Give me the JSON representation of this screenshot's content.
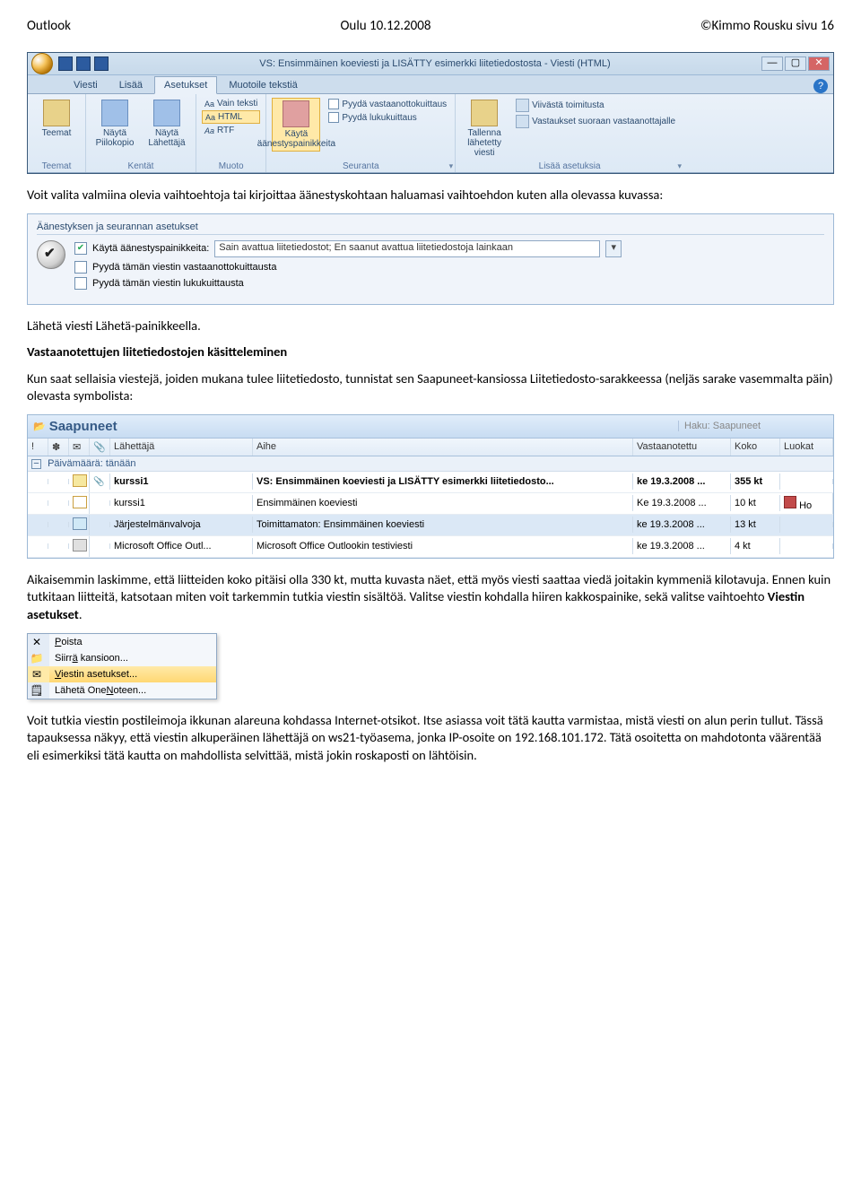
{
  "page_header": {
    "left": "Outlook",
    "center": "Oulu 10.12.2008",
    "right": "©Kimmo Rousku   sivu  16"
  },
  "outlook_window": {
    "title": "VS: Ensimmäinen koeviesti ja LISÄTTY esimerkki liitetiedostosta - Viesti (HTML)",
    "tabs": [
      "Viesti",
      "Lisää",
      "Asetukset",
      "Muotoile tekstiä"
    ],
    "active_tab": "Asetukset",
    "groups": {
      "teemat": "Teemat",
      "kentat": "Kentät",
      "muoto": "Muoto",
      "seuranta": "Seuranta",
      "lisaa": "Lisää asetuksia"
    },
    "buttons": {
      "teemat": "Teemat",
      "nayta_piilokopio": "Näytä Piilokopio",
      "nayta_lahettaja": "Näytä Lähettäjä",
      "vain_teksti": "Vain teksti",
      "html": "HTML",
      "rtf": "RTF",
      "kayta_aanestys": "Käytä äänestyspainikkeita",
      "pyyda_vastaanotto": "Pyydä vastaanottokuittaus",
      "pyyda_luku": "Pyydä lukukuittaus",
      "tallenna_lahetetty": "Tallenna lähetetty viesti",
      "viivasta": "Viivästä toimitusta",
      "vastaukset": "Vastaukset suoraan vastaanottajalle"
    }
  },
  "para1": "Voit valita valmiina olevia vaihtoehtoja tai kirjoittaa äänestyskohtaan haluamasi vaihtoehdon kuten alla olevassa kuvassa:",
  "vote_panel": {
    "heading": "Äänestyksen ja seurannan asetukset",
    "line1_label": "Käytä äänestyspainikkeita:",
    "line1_value": "Sain avattua liitetiedostot; En saanut avattua liitetiedostoja lainkaan",
    "line2": "Pyydä tämän viestin vastaanottokuittausta",
    "line3": "Pyydä tämän viestin lukukuittausta"
  },
  "para2": "Lähetä viesti Lähetä-painikkeella.",
  "heading1": "Vastaanotettujen liitetiedostojen käsitteleminen",
  "para3": "Kun saat sellaisia viestejä, joiden mukana tulee liitetiedosto, tunnistat sen Saapuneet-kansiossa Liitetiedosto-sarakkeessa (neljäs sarake vasemmalta päin) olevasta symbolista:",
  "inbox": {
    "title": "Saapuneet",
    "search": "Haku: Saapuneet",
    "cols": {
      "from": "Lähettäjä",
      "subject": "Aihe",
      "received": "Vastaanotettu",
      "size": "Koko",
      "categories": "Luokat"
    },
    "group": "Päivämäärä: tänään",
    "rows": [
      {
        "from": "kurssi1",
        "subj": "VS: Ensimmäinen koeviesti ja LISÄTTY esimerkki liitetiedosto...",
        "date": "ke 19.3.2008 ...",
        "size": "355 kt",
        "bold": true,
        "clip": true,
        "icon": "env"
      },
      {
        "from": "kurssi1",
        "subj": "Ensimmäinen koeviesti",
        "date": "Ke 19.3.2008 ...",
        "size": "10 kt",
        "cat": true,
        "cattext": "Ho",
        "icon": "envo"
      },
      {
        "from": "Järjestelmänvalvoja",
        "subj": "Toimittamaton: Ensimmäinen koeviesti",
        "date": "ke 19.3.2008 ...",
        "size": "13 kt",
        "sel": true,
        "icon": "sys"
      },
      {
        "from": "Microsoft Office Outl...",
        "subj": "Microsoft Office Outlookin testiviesti",
        "date": "ke 19.3.2008 ...",
        "size": "4 kt",
        "icon": "ms"
      }
    ]
  },
  "para4a": "Aikaisemmin laskimme, että liitteiden koko pitäisi olla 330 kt, mutta kuvasta näet, että myös viesti saattaa viedä joitakin kymmeniä kilotavuja. Ennen kuin tutkitaan liitteitä, katsotaan miten voit tarkemmin tutkia viestin sisältöä. Valitse viestin kohdalla hiiren kakkospainike, sekä valitse vaihtoehto ",
  "para4b": "Viestin asetukset",
  "para4c": ".",
  "ctx_menu": {
    "items": [
      {
        "icon": "✕",
        "label_pre": "",
        "u": "P",
        "label_post": "oista"
      },
      {
        "icon": "📁",
        "label_pre": "Siirr",
        "u": "ä",
        "label_post": " kansioon..."
      },
      {
        "icon": "✉",
        "label_pre": "",
        "u": "V",
        "label_post": "iestin asetukset...",
        "hl": true
      },
      {
        "icon": "🗒",
        "label_pre": "Lähetä One",
        "u": "N",
        "label_post": "oteen..."
      }
    ]
  },
  "para5": "Voit tutkia viestin postileimoja ikkunan alareuna kohdassa Internet-otsikot.  Itse asiassa voit tätä kautta varmistaa, mistä viesti on alun perin tullut. Tässä tapauksessa näkyy, että viestin alkuperäinen lähettäjä on ws21-työasema, jonka IP-osoite on 192.168.101.172. Tätä osoitetta on mahdotonta väärentää eli esimerkiksi tätä kautta on mahdollista selvittää, mistä jokin roskaposti on lähtöisin."
}
